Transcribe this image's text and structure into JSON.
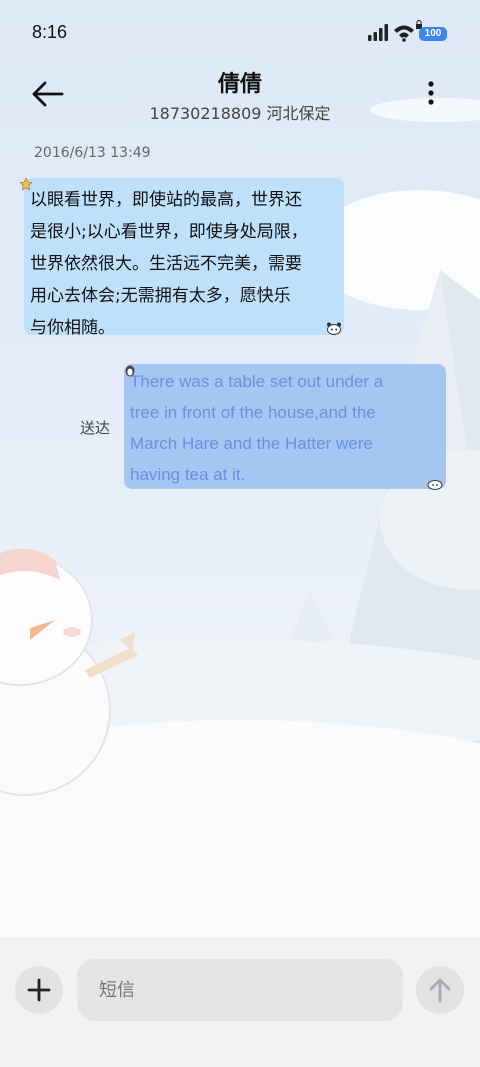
{
  "status_bar": {
    "time": "8:16",
    "battery": "100",
    "signal_icon": "signal-bars-icon",
    "wifi_icon": "wifi-icon",
    "battery_icon": "battery-icon"
  },
  "header": {
    "contact_name": "倩倩",
    "contact_detail": "18730218809 河北保定",
    "back_icon": "arrow-left-icon",
    "more_icon": "more-vertical-icon"
  },
  "conversation": {
    "timestamp": "2016/6/13 13:49",
    "messages": [
      {
        "direction": "incoming",
        "lines": [
          "以眼看世界，即使站的最高，世界还",
          "是很小;以心看世界，即使身处局限，",
          "世界依然很大。生活远不完美，需要",
          "用心去体会;无需拥有太多，愿快乐",
          "与你相随。"
        ]
      },
      {
        "direction": "outgoing",
        "status": "送达",
        "lines": [
          "There was a table set out under a",
          "tree in front of the house,and the",
          "March Hare and the Hatter were",
          "having tea at it."
        ]
      }
    ]
  },
  "input_bar": {
    "placeholder": "短信",
    "add_icon": "plus-icon",
    "send_icon": "arrow-up-icon"
  },
  "colors": {
    "incoming_bubble": "#bfe0fb",
    "outgoing_bubble": "#a4c6f0",
    "outgoing_text": "#6a8fe4",
    "battery": "#3d86ef"
  }
}
